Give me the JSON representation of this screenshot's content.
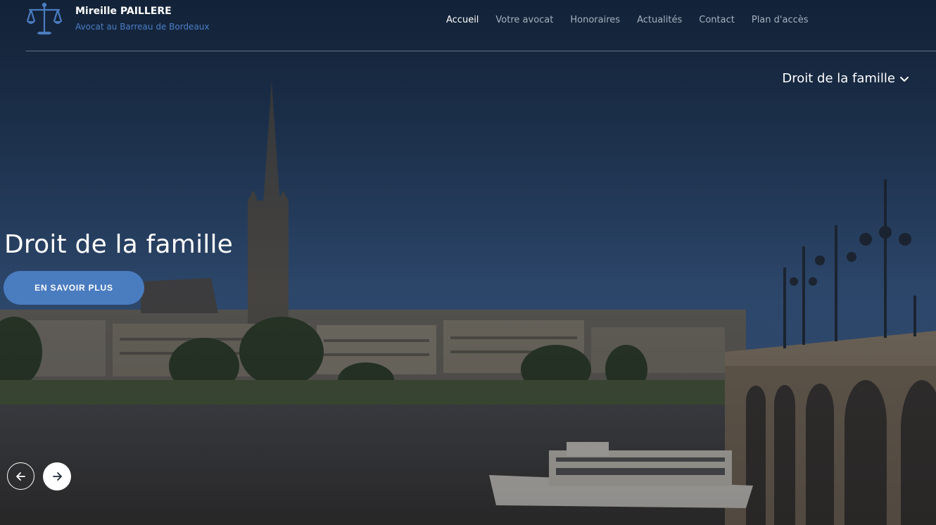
{
  "brand": {
    "name": "Mireille PAILLERE",
    "subtitle": "Avocat au Barreau de Bordeaux",
    "logo_icon": "scales-of-justice-icon"
  },
  "nav": {
    "items": [
      {
        "label": "Accueil",
        "active": true
      },
      {
        "label": "Votre avocat",
        "active": false
      },
      {
        "label": "Honoraires",
        "active": false
      },
      {
        "label": "Actualités",
        "active": false
      },
      {
        "label": "Contact",
        "active": false
      },
      {
        "label": "Plan d'accès",
        "active": false
      }
    ]
  },
  "category_dropdown": {
    "label": "Droit de la famille",
    "icon": "chevron-down-icon"
  },
  "hero": {
    "title": "Droit de la famille",
    "cta_label": "EN SAVOIR PLUS",
    "background_description_icon": "bordeaux-cityscape-image"
  },
  "carousel": {
    "prev_icon": "arrow-left-icon",
    "next_icon": "arrow-right-icon"
  },
  "colors": {
    "accent": "#4a7cc0",
    "brand_subtitle": "#4a7fc8",
    "nav_inactive": "#a7b2c0"
  }
}
